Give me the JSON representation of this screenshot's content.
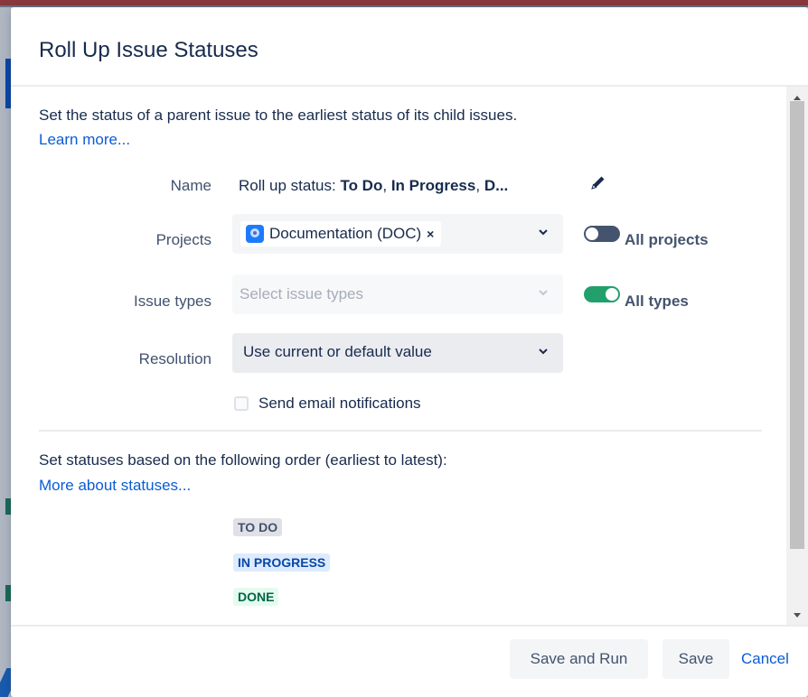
{
  "dialog": {
    "title": "Roll Up Issue Statuses",
    "intro": "Set the status of a parent issue to the earliest status of its child issues.",
    "learn_more": "Learn more..."
  },
  "form": {
    "name_label": "Name",
    "name_value": {
      "prefix": "Roll up status: ",
      "s1": "To Do",
      "sep1": ", ",
      "s2": "In Progress",
      "sep2": ", ",
      "s3": "D..."
    },
    "projects_label": "Projects",
    "project_chip": "Documentation (DOC)",
    "project_chip_remove": "×",
    "all_projects_label": "All projects",
    "all_projects_on": false,
    "issue_types_label": "Issue types",
    "issue_types_placeholder": "Select issue types",
    "all_types_label": "All types",
    "all_types_on": true,
    "resolution_label": "Resolution",
    "resolution_value": "Use current or default value",
    "email_label": "Send email notifications",
    "email_checked": false
  },
  "statuses": {
    "order_text": "Set statuses based on the following order (earliest to latest):",
    "more_link": "More about statuses...",
    "items": [
      "TO DO",
      "IN PROGRESS",
      "DONE"
    ]
  },
  "footer": {
    "save_run": "Save and Run",
    "save": "Save",
    "cancel": "Cancel"
  },
  "colors": {
    "link": "#0b5cd5",
    "toggle_on": "#22a06b",
    "toggle_off": "#44546f",
    "todo_bg": "#dfe1e6",
    "inprogress_bg": "#deebff",
    "done_bg": "#e3fcef"
  },
  "icons": {
    "edit": "pencil-icon",
    "chevron": "chevron-down-icon",
    "project": "project-avatar-icon"
  }
}
